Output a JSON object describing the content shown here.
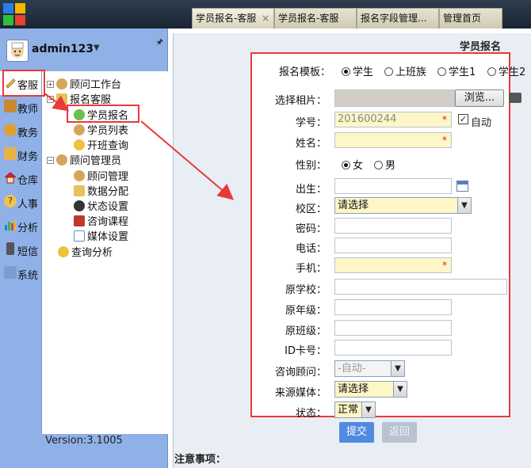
{
  "app": {
    "version": "Version:3.1005",
    "user": "admin123"
  },
  "tabs": [
    {
      "label": "学员报名-客服",
      "active": true,
      "close": "×"
    },
    {
      "label": "学员报名-客服"
    },
    {
      "label": "报名字段管理..."
    },
    {
      "label": "管理首页"
    }
  ],
  "modules": [
    {
      "label": "客服",
      "icon": "pencil-icon",
      "active": true
    },
    {
      "label": "教师",
      "icon": "book-icon"
    },
    {
      "label": "教务",
      "icon": "flowers-icon"
    },
    {
      "label": "财务",
      "icon": "money-icon"
    },
    {
      "label": "仓库",
      "icon": "house-icon"
    },
    {
      "label": "人事",
      "icon": "question-icon"
    },
    {
      "label": "分析",
      "icon": "bar-chart-icon"
    },
    {
      "label": "短信",
      "icon": "phone-icon"
    },
    {
      "label": "系统",
      "icon": "tools-icon"
    }
  ],
  "tree": [
    {
      "label": "顾问工作台",
      "toggle": "+",
      "icon": "user-icon"
    },
    {
      "label": "报名客服",
      "toggle": "−",
      "icon": "edit-icon"
    },
    {
      "label": "学员报名",
      "icon": "user-add-icon",
      "selected": true
    },
    {
      "label": "学员列表",
      "icon": "users-icon"
    },
    {
      "label": "开班查询",
      "icon": "search-icon"
    },
    {
      "label": "顾问管理员",
      "toggle": "−",
      "icon": "user-icon"
    },
    {
      "label": "顾问管理",
      "icon": "user-icon"
    },
    {
      "label": "数据分配",
      "icon": "swap-icon"
    },
    {
      "label": "状态设置",
      "icon": "ball-icon"
    },
    {
      "label": "咨询课程",
      "icon": "books-icon"
    },
    {
      "label": "媒体设置",
      "icon": "media-icon"
    },
    {
      "label": "查询分析",
      "icon": "search-icon"
    }
  ],
  "main": {
    "title": "学员报名",
    "notes": "注意事项："
  },
  "form": {
    "template_label": "报名模板：",
    "template_options": [
      {
        "label": "学生",
        "checked": true
      },
      {
        "label": "上班族"
      },
      {
        "label": "学生1"
      },
      {
        "label": "学生2"
      }
    ],
    "photo_label": "选择相片：",
    "browse_label": "浏览...",
    "student_no_label": "学号：",
    "student_no_value": "201600244",
    "required_mark": "*",
    "auto_label": "自动",
    "auto_checked": true,
    "name_label": "姓名：",
    "gender_label": "性别：",
    "gender_options": [
      {
        "label": "女",
        "checked": true
      },
      {
        "label": "男"
      }
    ],
    "birth_label": "出生：",
    "campus_label": "校区：",
    "campus_value": "请选择",
    "password_label": "密码：",
    "phone_label": "电话：",
    "mobile_label": "手机：",
    "school_label": "原学校：",
    "grade_label": "原年级：",
    "class_label": "原班级：",
    "id_card_label": "ID卡号：",
    "advisor_label": "咨询顾问：",
    "advisor_value": "-自动-",
    "source_label": "来源媒体：",
    "source_value": "请选择",
    "status_label": "状态：",
    "status_value": "正常",
    "submit_label": "提交",
    "back_label": "返回"
  },
  "colors": {
    "accent_red": "#e83a3a",
    "panel_blue": "#8fb1e8",
    "button_blue": "#4f8be0",
    "required_bg": "#fdf6c7"
  }
}
